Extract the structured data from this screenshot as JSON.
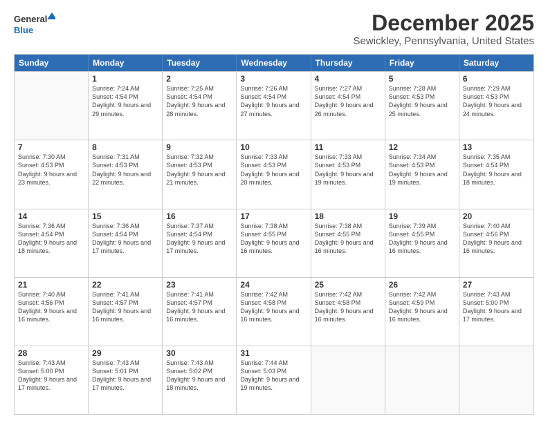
{
  "logo": {
    "line1": "General",
    "line2": "Blue"
  },
  "title": "December 2025",
  "subtitle": "Sewickley, Pennsylvania, United States",
  "days": [
    "Sunday",
    "Monday",
    "Tuesday",
    "Wednesday",
    "Thursday",
    "Friday",
    "Saturday"
  ],
  "weeks": [
    [
      {
        "day": "",
        "sunrise": "",
        "sunset": "",
        "daylight": ""
      },
      {
        "day": "1",
        "sunrise": "Sunrise: 7:24 AM",
        "sunset": "Sunset: 4:54 PM",
        "daylight": "Daylight: 9 hours and 29 minutes."
      },
      {
        "day": "2",
        "sunrise": "Sunrise: 7:25 AM",
        "sunset": "Sunset: 4:54 PM",
        "daylight": "Daylight: 9 hours and 28 minutes."
      },
      {
        "day": "3",
        "sunrise": "Sunrise: 7:26 AM",
        "sunset": "Sunset: 4:54 PM",
        "daylight": "Daylight: 9 hours and 27 minutes."
      },
      {
        "day": "4",
        "sunrise": "Sunrise: 7:27 AM",
        "sunset": "Sunset: 4:54 PM",
        "daylight": "Daylight: 9 hours and 26 minutes."
      },
      {
        "day": "5",
        "sunrise": "Sunrise: 7:28 AM",
        "sunset": "Sunset: 4:53 PM",
        "daylight": "Daylight: 9 hours and 25 minutes."
      },
      {
        "day": "6",
        "sunrise": "Sunrise: 7:29 AM",
        "sunset": "Sunset: 4:53 PM",
        "daylight": "Daylight: 9 hours and 24 minutes."
      }
    ],
    [
      {
        "day": "7",
        "sunrise": "Sunrise: 7:30 AM",
        "sunset": "Sunset: 4:53 PM",
        "daylight": "Daylight: 9 hours and 23 minutes."
      },
      {
        "day": "8",
        "sunrise": "Sunrise: 7:31 AM",
        "sunset": "Sunset: 4:53 PM",
        "daylight": "Daylight: 9 hours and 22 minutes."
      },
      {
        "day": "9",
        "sunrise": "Sunrise: 7:32 AM",
        "sunset": "Sunset: 4:53 PM",
        "daylight": "Daylight: 9 hours and 21 minutes."
      },
      {
        "day": "10",
        "sunrise": "Sunrise: 7:33 AM",
        "sunset": "Sunset: 4:53 PM",
        "daylight": "Daylight: 9 hours and 20 minutes."
      },
      {
        "day": "11",
        "sunrise": "Sunrise: 7:33 AM",
        "sunset": "Sunset: 4:53 PM",
        "daylight": "Daylight: 9 hours and 19 minutes."
      },
      {
        "day": "12",
        "sunrise": "Sunrise: 7:34 AM",
        "sunset": "Sunset: 4:53 PM",
        "daylight": "Daylight: 9 hours and 19 minutes."
      },
      {
        "day": "13",
        "sunrise": "Sunrise: 7:35 AM",
        "sunset": "Sunset: 4:54 PM",
        "daylight": "Daylight: 9 hours and 18 minutes."
      }
    ],
    [
      {
        "day": "14",
        "sunrise": "Sunrise: 7:36 AM",
        "sunset": "Sunset: 4:54 PM",
        "daylight": "Daylight: 9 hours and 18 minutes."
      },
      {
        "day": "15",
        "sunrise": "Sunrise: 7:36 AM",
        "sunset": "Sunset: 4:54 PM",
        "daylight": "Daylight: 9 hours and 17 minutes."
      },
      {
        "day": "16",
        "sunrise": "Sunrise: 7:37 AM",
        "sunset": "Sunset: 4:54 PM",
        "daylight": "Daylight: 9 hours and 17 minutes."
      },
      {
        "day": "17",
        "sunrise": "Sunrise: 7:38 AM",
        "sunset": "Sunset: 4:55 PM",
        "daylight": "Daylight: 9 hours and 16 minutes."
      },
      {
        "day": "18",
        "sunrise": "Sunrise: 7:38 AM",
        "sunset": "Sunset: 4:55 PM",
        "daylight": "Daylight: 9 hours and 16 minutes."
      },
      {
        "day": "19",
        "sunrise": "Sunrise: 7:39 AM",
        "sunset": "Sunset: 4:55 PM",
        "daylight": "Daylight: 9 hours and 16 minutes."
      },
      {
        "day": "20",
        "sunrise": "Sunrise: 7:40 AM",
        "sunset": "Sunset: 4:56 PM",
        "daylight": "Daylight: 9 hours and 16 minutes."
      }
    ],
    [
      {
        "day": "21",
        "sunrise": "Sunrise: 7:40 AM",
        "sunset": "Sunset: 4:56 PM",
        "daylight": "Daylight: 9 hours and 16 minutes."
      },
      {
        "day": "22",
        "sunrise": "Sunrise: 7:41 AM",
        "sunset": "Sunset: 4:57 PM",
        "daylight": "Daylight: 9 hours and 16 minutes."
      },
      {
        "day": "23",
        "sunrise": "Sunrise: 7:41 AM",
        "sunset": "Sunset: 4:57 PM",
        "daylight": "Daylight: 9 hours and 16 minutes."
      },
      {
        "day": "24",
        "sunrise": "Sunrise: 7:42 AM",
        "sunset": "Sunset: 4:58 PM",
        "daylight": "Daylight: 9 hours and 16 minutes."
      },
      {
        "day": "25",
        "sunrise": "Sunrise: 7:42 AM",
        "sunset": "Sunset: 4:58 PM",
        "daylight": "Daylight: 9 hours and 16 minutes."
      },
      {
        "day": "26",
        "sunrise": "Sunrise: 7:42 AM",
        "sunset": "Sunset: 4:59 PM",
        "daylight": "Daylight: 9 hours and 16 minutes."
      },
      {
        "day": "27",
        "sunrise": "Sunrise: 7:43 AM",
        "sunset": "Sunset: 5:00 PM",
        "daylight": "Daylight: 9 hours and 17 minutes."
      }
    ],
    [
      {
        "day": "28",
        "sunrise": "Sunrise: 7:43 AM",
        "sunset": "Sunset: 5:00 PM",
        "daylight": "Daylight: 9 hours and 17 minutes."
      },
      {
        "day": "29",
        "sunrise": "Sunrise: 7:43 AM",
        "sunset": "Sunset: 5:01 PM",
        "daylight": "Daylight: 9 hours and 17 minutes."
      },
      {
        "day": "30",
        "sunrise": "Sunrise: 7:43 AM",
        "sunset": "Sunset: 5:02 PM",
        "daylight": "Daylight: 9 hours and 18 minutes."
      },
      {
        "day": "31",
        "sunrise": "Sunrise: 7:44 AM",
        "sunset": "Sunset: 5:03 PM",
        "daylight": "Daylight: 9 hours and 19 minutes."
      },
      {
        "day": "",
        "sunrise": "",
        "sunset": "",
        "daylight": ""
      },
      {
        "day": "",
        "sunrise": "",
        "sunset": "",
        "daylight": ""
      },
      {
        "day": "",
        "sunrise": "",
        "sunset": "",
        "daylight": ""
      }
    ]
  ]
}
